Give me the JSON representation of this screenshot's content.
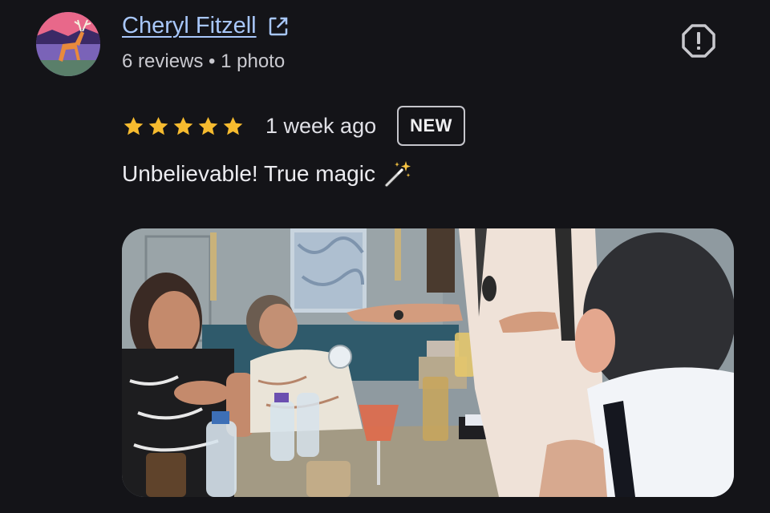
{
  "reviewer": {
    "name": "Cheryl Fitzell",
    "meta": "6 reviews • 1 photo",
    "avatar_icon": "deer-avatar"
  },
  "icons": {
    "open_external": "open-in-new-icon",
    "report": "report-icon",
    "star": "star-icon",
    "magic_wand": "magic-wand-emoji"
  },
  "rating": {
    "stars": 5,
    "max": 5,
    "star_color": "#f6bb2f"
  },
  "time_ago": "1 week ago",
  "badge": "NEW",
  "review_text": "Unbelievable! True magic",
  "photo": {
    "subject": "review-photo"
  },
  "colors": {
    "background": "#141418",
    "link": "#a8c7fa"
  }
}
